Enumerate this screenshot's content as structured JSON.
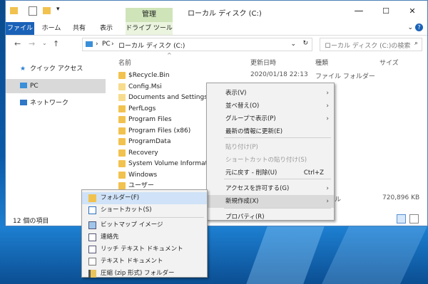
{
  "window": {
    "title": "ローカル ディスク (C:)",
    "contextual_tab_header": "管理",
    "ribbon_tabs": [
      "ファイル",
      "ホーム",
      "共有",
      "表示",
      "ドライブ ツール"
    ],
    "address_path": [
      "PC",
      "ローカル ディスク (C:)"
    ],
    "search_placeholder": "ローカル ディスク (C:)の検索",
    "window_controls": [
      "—",
      "☐",
      "✕"
    ]
  },
  "nav": {
    "quick_access": "クイック アクセス",
    "pc": "PC",
    "network": "ネットワーク"
  },
  "columns": [
    "名前",
    "更新日時",
    "種類",
    "サイズ"
  ],
  "files": [
    {
      "name": "$Recycle.Bin",
      "date": "2020/01/18 22:13",
      "type": "ファイル フォルダー"
    },
    {
      "name": "Config.Msi"
    },
    {
      "name": "Documents and Settings"
    },
    {
      "name": "PerfLogs"
    },
    {
      "name": "Program Files"
    },
    {
      "name": "Program Files (x86)"
    },
    {
      "name": "ProgramData"
    },
    {
      "name": "Recovery"
    },
    {
      "name": "System Volume Information"
    },
    {
      "name": "Windows"
    },
    {
      "name": "ユーザー"
    }
  ],
  "partial_row": {
    "type": "ファイル",
    "size": "720,896 KB"
  },
  "status": "12 個の項目",
  "context_menu": [
    {
      "label": "表示(V)",
      "arrow": true
    },
    {
      "label": "並べ替え(O)",
      "arrow": true
    },
    {
      "label": "グループで表示(P)",
      "arrow": true
    },
    {
      "label": "最新の情報に更新(E)"
    },
    {
      "label": "貼り付け(P)",
      "disabled": true
    },
    {
      "label": "ショートカットの貼り付け(S)",
      "disabled": true
    },
    {
      "label": "元に戻す - 削除(U)",
      "shortcut": "Ctrl+Z"
    },
    {
      "label": "アクセスを許可する(G)",
      "arrow": true
    },
    {
      "label": "新規作成(X)",
      "arrow": true,
      "highlight": true
    },
    {
      "label": "プロパティ(R)"
    }
  ],
  "submenu": [
    {
      "label": "フォルダー(F)",
      "icon": "folder-icon"
    },
    {
      "label": "ショートカット(S)",
      "icon": "shortcut-icon"
    },
    {
      "label": "ビットマップ イメージ",
      "icon": "bitmap-icon"
    },
    {
      "label": "連絡先",
      "icon": "contact-icon"
    },
    {
      "label": "リッチ テキスト ドキュメント",
      "icon": "rtf-document-icon"
    },
    {
      "label": "テキスト ドキュメント",
      "icon": "text-document-icon"
    },
    {
      "label": "圧縮 (zip 形式) フォルダー",
      "icon": "zip-folder-icon"
    }
  ],
  "colors": {
    "file_tab": "#1a62b8",
    "contextual": "#cfe5b9",
    "folder": "#f2c24f",
    "desktop": "#0b5aa8"
  }
}
